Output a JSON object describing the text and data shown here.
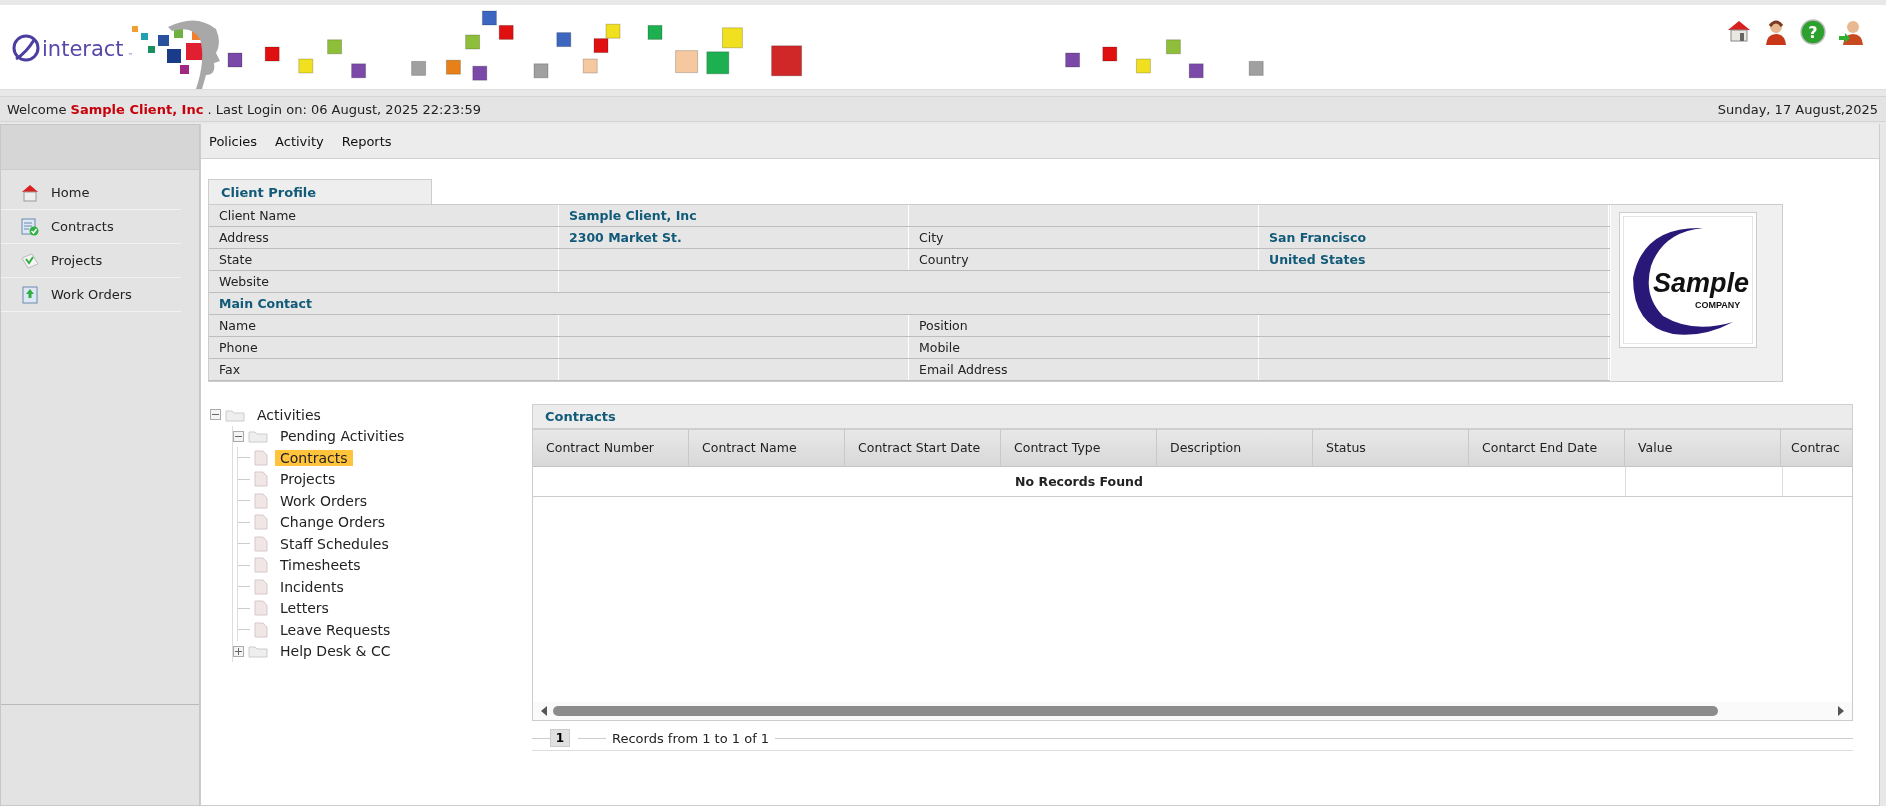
{
  "header": {
    "brand": "interact",
    "brand_mark": "™",
    "help_glyph": "?"
  },
  "welcome": {
    "text": "Welcome **Sample Client, Inc** . Last Login on: 06 August, 2025 22:23:59",
    "date": "Sunday, 17 August,2025"
  },
  "sidebar": {
    "items": [
      {
        "label": "Home",
        "kind": "home"
      },
      {
        "label": "Contracts",
        "kind": "contracts"
      },
      {
        "label": "Projects",
        "kind": "projects"
      },
      {
        "label": "Work Orders",
        "kind": "work-orders"
      }
    ]
  },
  "menu": [
    "Policies",
    "Activity",
    "Reports"
  ],
  "client_profile": {
    "title": "Client Profile",
    "rows": [
      {
        "kind": "field",
        "label": "Client Name",
        "value": "Sample Client, Inc"
      },
      {
        "kind": "field",
        "label": "Address",
        "value": "2300 Market St.",
        "label2": "City",
        "value2": "San Francisco"
      },
      {
        "kind": "field",
        "label": "State",
        "label2": "Country",
        "value2": "United States"
      },
      {
        "kind": "wide",
        "label": "Website"
      },
      {
        "kind": "section",
        "label": "Main Contact"
      },
      {
        "kind": "field",
        "label": "Name",
        "label2": "Position"
      },
      {
        "kind": "field",
        "label": "Phone",
        "label2": "Mobile"
      },
      {
        "kind": "field",
        "label": "Fax",
        "label2": "Email Address"
      }
    ],
    "logo": {
      "name": "Sample",
      "tagline": "COMPANY"
    }
  },
  "tree": [
    {
      "label": "Activities",
      "expanded": true,
      "children": [
        {
          "label": "Pending Activities",
          "expanded": true,
          "children": [
            {
              "label": "Contracts",
              "selected": true
            },
            {
              "label": "Projects",
              "selected": false
            },
            {
              "label": "Work Orders",
              "selected": false
            },
            {
              "label": "Change Orders",
              "selected": false
            },
            {
              "label": "Staff Schedules",
              "selected": false
            },
            {
              "label": "Timesheets",
              "selected": false
            },
            {
              "label": "Incidents",
              "selected": false
            },
            {
              "label": "Letters",
              "selected": false
            },
            {
              "label": "Leave Requests",
              "selected": false
            }
          ]
        },
        {
          "label": "Help Desk & CC",
          "expanded": false
        }
      ]
    }
  ],
  "contracts": {
    "title": "Contracts",
    "columns": [
      "Contract Number",
      "Contract Name",
      "Contract Start Date",
      "Contract Type",
      "Description",
      "Status",
      "Contarct End Date",
      "Value",
      "Contrac"
    ],
    "empty_message": "No Records Found",
    "pager": {
      "page": "1",
      "summary": "Records from 1 to 1 of 1"
    }
  }
}
